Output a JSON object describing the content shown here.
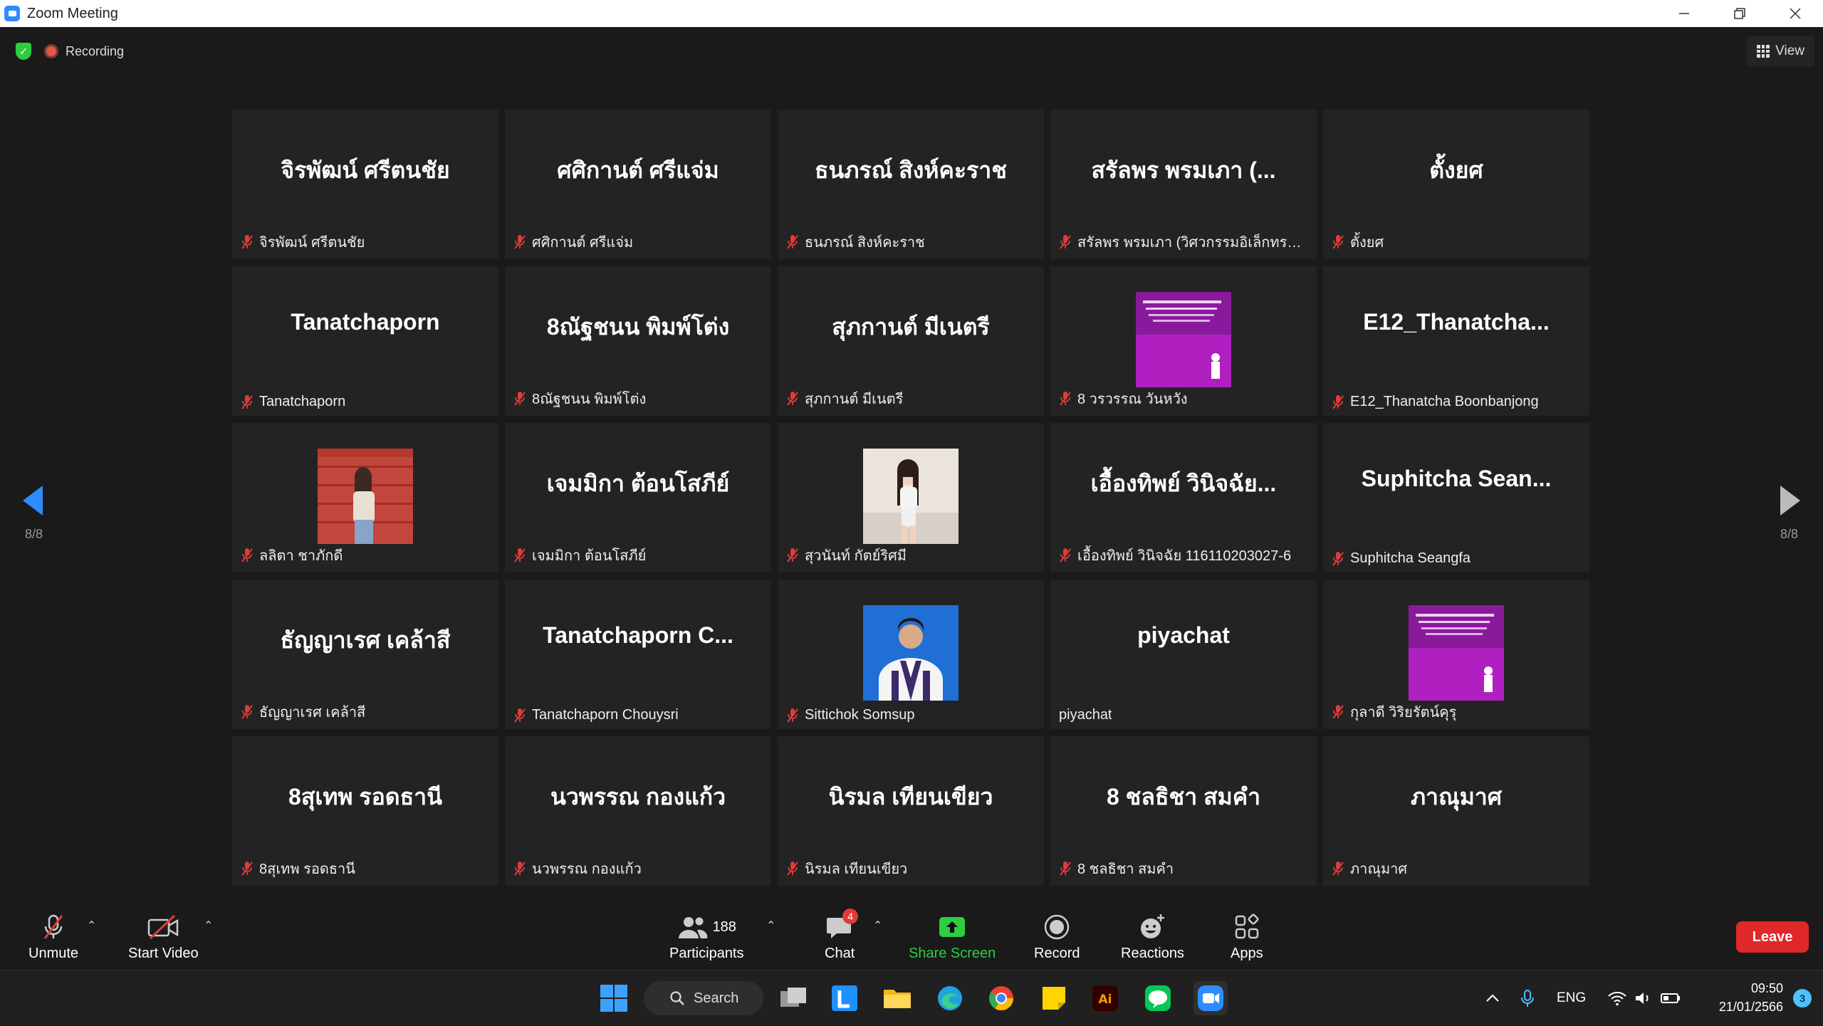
{
  "window": {
    "title": "Zoom Meeting"
  },
  "meeting": {
    "recording_label": "Recording",
    "view_label": "View",
    "page_left": "8/8",
    "page_right": "8/8"
  },
  "tiles": [
    {
      "big": "จิรพัฒน์ ศรีตนชัย",
      "caption": "จิรพัฒน์ ศรีตนชัย",
      "muted": true
    },
    {
      "big": "ศศิกานต์ ศรีแจ่ม",
      "caption": "ศศิกานต์ ศรีแจ่ม",
      "muted": true
    },
    {
      "big": "ธนภรณ์ สิงห์คะราช",
      "caption": "ธนภรณ์ สิงห์คะราช",
      "muted": true
    },
    {
      "big": "สรัลพร พรมเภา (...",
      "caption": "สรัลพร พรมเภา (วิศวกรรมอิเล็กทรอนิก...",
      "muted": true
    },
    {
      "big": "ตั้งยศ",
      "caption": "ตั้งยศ",
      "muted": true
    },
    {
      "big": "Tanatchaporn",
      "caption": "Tanatchaporn",
      "muted": true
    },
    {
      "big": "8ณัฐชนน พิมพ์โต่ง",
      "caption": "8ณัฐชนน พิมพ์โต่ง",
      "muted": true
    },
    {
      "big": "สุภกานต์ มีเนตรี",
      "caption": "สุภกานต์ มีเนตรี",
      "muted": true
    },
    {
      "big": "",
      "caption": "8 วรวรรณ วันหวัง",
      "muted": true,
      "photo": "purple-slide"
    },
    {
      "big": "E12_Thanatcha...",
      "caption": "E12_Thanatcha Boonbanjong",
      "muted": true
    },
    {
      "big": "",
      "caption": "ลลิตา ชาภักดี",
      "muted": true,
      "photo": "red-wall-person"
    },
    {
      "big": "เจมมิกา  ต้อนโสภีย์",
      "caption": "เจมมิกา  ต้อนโสภีย์",
      "muted": true
    },
    {
      "big": "",
      "caption": "สุวนันท์ กัตย์ริศมี",
      "muted": true,
      "photo": "light-room-person"
    },
    {
      "big": "เอื้องทิพย์ วินิจฉัย...",
      "caption": "เอื้องทิพย์ วินิจฉัย 116110203027-6",
      "muted": true
    },
    {
      "big": "Suphitcha  Sean...",
      "caption": "Suphitcha Seangfa",
      "muted": true
    },
    {
      "big": "ธัญญาเรศ เคล้าสี",
      "caption": "ธัญญาเรศ เคล้าสี",
      "muted": true
    },
    {
      "big": "Tanatchaporn  C...",
      "caption": "Tanatchaporn Chouysri",
      "muted": true
    },
    {
      "big": "",
      "caption": "Sittichok Somsup",
      "muted": true,
      "photo": "blue-portrait"
    },
    {
      "big": "piyachat",
      "caption": "piyachat",
      "muted": false
    },
    {
      "big": "",
      "caption": "กุลาดี วิริยรัตน์คุรุ",
      "muted": true,
      "photo": "purple-slide"
    },
    {
      "big": "8สุเทพ รอดธานี",
      "caption": "8สุเทพ รอดธานี",
      "muted": true
    },
    {
      "big": "นวพรรณ กองแก้ว",
      "caption": "นวพรรณ กองแก้ว",
      "muted": true
    },
    {
      "big": "นิรมล เทียนเขียว",
      "caption": "นิรมล เทียนเขียว",
      "muted": true
    },
    {
      "big": "8 ชลธิชา สมคำ",
      "caption": "8 ชลธิชา สมคำ",
      "muted": true
    },
    {
      "big": "ภาณุมาศ",
      "caption": "ภาณุมาศ",
      "muted": true
    }
  ],
  "toolbar": {
    "unmute": "Unmute",
    "start_video": "Start Video",
    "participants": "Participants",
    "participants_count": "188",
    "chat": "Chat",
    "chat_badge": "4",
    "share_screen": "Share Screen",
    "record": "Record",
    "reactions": "Reactions",
    "apps": "Apps",
    "leave": "Leave",
    "share_color": "#2ecc40",
    "leave_color": "#e02828"
  },
  "taskbar": {
    "search": "Search",
    "lang": "ENG",
    "time": "09:50",
    "date": "21/01/2566",
    "notifications": "3"
  }
}
